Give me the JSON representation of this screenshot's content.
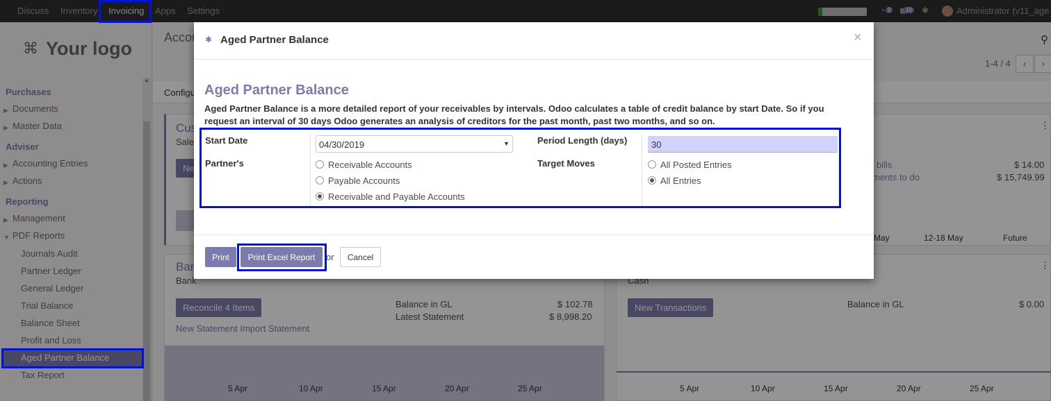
{
  "navbar": {
    "items": [
      "Discuss",
      "Inventory",
      "Invoicing",
      "Apps",
      "Settings"
    ],
    "chat_count": "2",
    "activity_count": "10",
    "user": "Administrator (v11_age"
  },
  "sidebar": {
    "logo": "Your logo",
    "sections": [
      {
        "title": "Purchases",
        "items": [
          "Documents",
          "Master Data"
        ]
      },
      {
        "title": "Adviser",
        "items": [
          "Accounting Entries",
          "Actions"
        ]
      },
      {
        "title": "Reporting",
        "items": [
          "Management",
          "PDF Reports"
        ]
      }
    ],
    "pdf_reports": [
      "Journals Audit",
      "Partner Ledger",
      "General Ledger",
      "Trial Balance",
      "Balance Sheet",
      "Profit and Loss",
      "Aged Partner Balance",
      "Tax Report"
    ],
    "selected": "Aged Partner Balance"
  },
  "background": {
    "title_fragment": "Accou",
    "config_fragment": "Configu",
    "pager": "1-4 / 4",
    "card_top_left": {
      "title": "Cus",
      "subtitle": "Sale",
      "button": "Ne"
    },
    "card_top_right": {
      "rows": [
        {
          "label": "bills",
          "value": "$ 14.00"
        },
        {
          "label": "ments to do",
          "value": "$ 15,749.99"
        }
      ],
      "axis": [
        "May",
        "12-18 May",
        "Future"
      ]
    },
    "bank": {
      "title": "Ban",
      "subtitle": "Bank",
      "reconcile": "Reconcile 4 Items",
      "rows": [
        {
          "label": "Balance in GL",
          "value": "$ 102.78"
        },
        {
          "label": "Latest Statement",
          "value": "$ 8,998.20"
        }
      ],
      "links": "New Statement Import Statement",
      "axis": [
        "5 Apr",
        "10 Apr",
        "15 Apr",
        "20 Apr",
        "25 Apr"
      ]
    },
    "cash": {
      "subtitle": "Cash",
      "button": "New Transactions",
      "row": {
        "label": "Balance in GL",
        "value": "$ 0.00"
      },
      "axis": [
        "5 Apr",
        "10 Apr",
        "15 Apr",
        "20 Apr",
        "25 Apr"
      ]
    }
  },
  "dialog": {
    "header": "Aged Partner Balance",
    "close": "×",
    "title": "Aged Partner Balance",
    "description": "Aged Partner Balance is a more detailed report of your receivables by intervals. Odoo calculates a table of credit balance by start Date. So if you request an interval of 30 days Odoo generates an analysis of creditors for the past month, past two months, and so on.",
    "start_date_label": "Start Date",
    "start_date": "04/30/2019",
    "period_label": "Period Length (days)",
    "period": "30",
    "partners_label": "Partner's",
    "partner_options": [
      "Receivable Accounts",
      "Payable Accounts",
      "Receivable and Payable Accounts"
    ],
    "partner_selected": 2,
    "target_label": "Target Moves",
    "target_options": [
      "All Posted Entries",
      "All Entries"
    ],
    "target_selected": 1,
    "print": "Print",
    "print_excel": "Print Excel Report",
    "or": "or",
    "cancel": "Cancel"
  },
  "colors": {
    "accent": "#7c7bad",
    "highlight": "#0014d6",
    "navbar": "#2f2f2f"
  }
}
